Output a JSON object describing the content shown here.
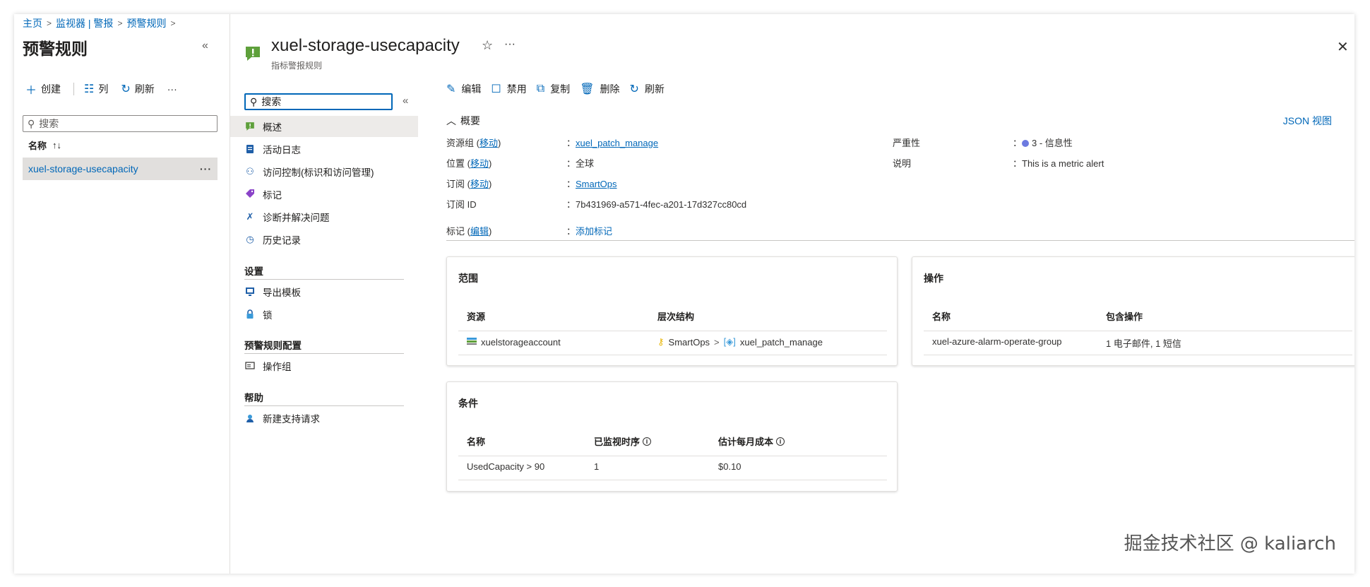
{
  "breadcrumb": {
    "home": "主页",
    "monitor": "监视器 | 警报",
    "rules": "预警规则"
  },
  "left_blade": {
    "title": "预警规则",
    "toolbar": {
      "create": "创建",
      "columns": "列",
      "refresh": "刷新"
    },
    "search_placeholder": "搜索",
    "col_name": "名称",
    "rows": [
      {
        "name": "xuel-storage-usecapacity"
      }
    ]
  },
  "resource": {
    "title": "xuel-storage-usecapacity",
    "subtitle": "指标警报规则"
  },
  "menu": {
    "search_placeholder": "搜索",
    "items": [
      {
        "label": "概述"
      },
      {
        "label": "活动日志"
      },
      {
        "label": "访问控制(标识和访问管理)"
      },
      {
        "label": "标记"
      },
      {
        "label": "诊断并解决问题"
      },
      {
        "label": "历史记录"
      }
    ],
    "sections": {
      "settings": "设置",
      "settings_items": [
        {
          "label": "导出模板"
        },
        {
          "label": "锁"
        }
      ],
      "config": "预警规则配置",
      "config_items": [
        {
          "label": "操作组"
        }
      ],
      "help": "帮助",
      "help_items": [
        {
          "label": "新建支持请求"
        }
      ]
    }
  },
  "commands": {
    "edit": "编辑",
    "disable": "禁用",
    "copy": "复制",
    "delete": "删除",
    "refresh": "刷新"
  },
  "essentials": {
    "header": "概要",
    "json_view": "JSON 视图",
    "resource_group_label": "资源组 (",
    "move": "移动",
    "close_paren": ")",
    "resource_group_value": "xuel_patch_manage",
    "location_label": "位置 (",
    "location_value": "全球",
    "subscription_label": "订阅 (",
    "subscription_value": "SmartOps",
    "subscription_id_label": "订阅 ID",
    "subscription_id_value": "7b431969-a571-4fec-a201-17d327cc80cd",
    "tags_label": "标记 (",
    "edit": "编辑",
    "tags_value": "添加标记",
    "severity_label": "严重性",
    "severity_value": "3 - 信息性",
    "severity_color": "#6c7ae0",
    "description_label": "说明",
    "description_value": "This is a metric alert",
    "colon": "："
  },
  "scope_card": {
    "title": "范围",
    "headers": {
      "resource": "资源",
      "hierarchy": "层次结构"
    },
    "row": {
      "resource": "xuelstorageaccount",
      "sub": "SmartOps",
      "rg": "xuel_patch_manage"
    }
  },
  "actions_card": {
    "title": "操作",
    "headers": {
      "name": "名称",
      "contains": "包含操作"
    },
    "row": {
      "name": "xuel-azure-alarm-operate-group",
      "contains": "1 电子邮件, 1 短信"
    }
  },
  "conditions_card": {
    "title": "条件",
    "headers": {
      "name": "名称",
      "monitored": "已监视时序",
      "cost": "估计每月成本"
    },
    "row": {
      "name": "UsedCapacity > 90",
      "monitored": "1",
      "cost": "$0.10"
    }
  },
  "watermark": "掘金技术社区 @ kaliarch"
}
